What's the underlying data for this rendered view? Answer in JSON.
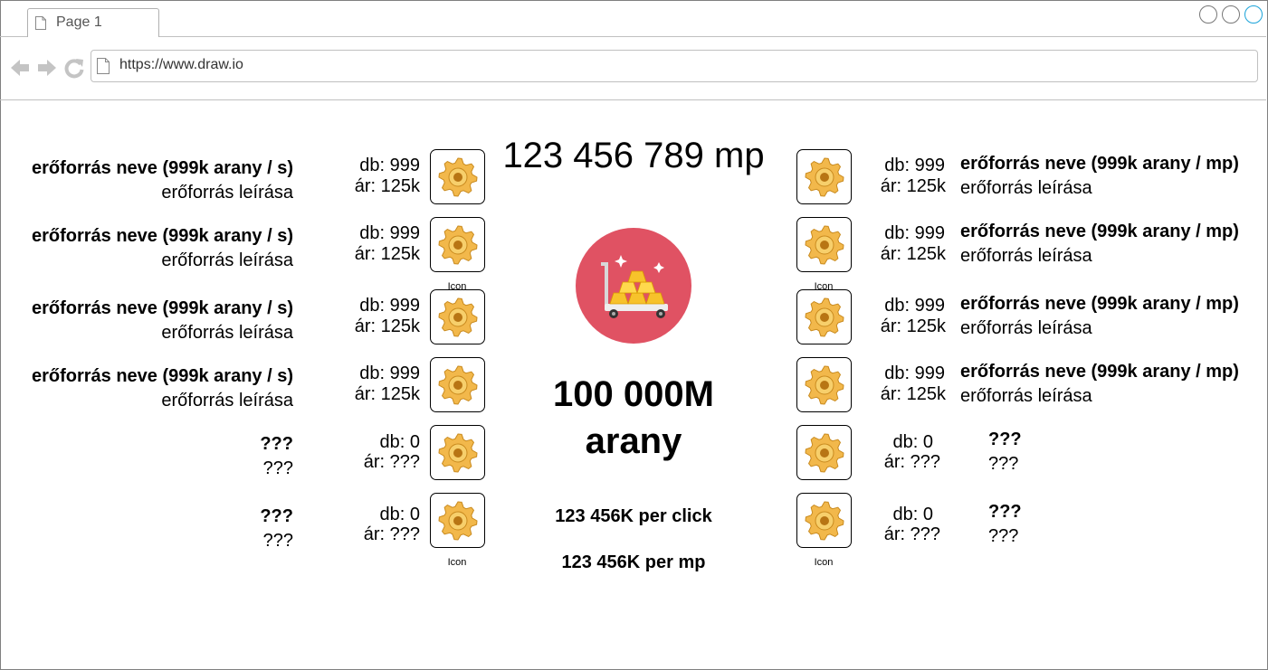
{
  "browser": {
    "tab_title": "Page 1",
    "url": "https://www.draw.io"
  },
  "game": {
    "time_counter": "123 456 789 mp",
    "gold_total_line1": "100 000M",
    "gold_total_line2": "arany",
    "per_click": "123 456K per click",
    "per_second": "123 456K per mp",
    "click_button_icon": "gold-cart-icon"
  },
  "left_resources": [
    {
      "name": "erőforrás neve (999k arany / s)",
      "desc": "erőforrás leírása",
      "count": "db: 999",
      "price": "ár: 125k"
    },
    {
      "name": "erőforrás neve (999k arany / s)",
      "desc": "erőforrás leírása",
      "count": "db: 999",
      "price": "ár: 125k"
    },
    {
      "name": "erőforrás neve (999k arany / s)",
      "desc": "erőforrás leírása",
      "count": "db: 999",
      "price": "ár: 125k"
    },
    {
      "name": "erőforrás neve (999k arany / s)",
      "desc": "erőforrás leírása",
      "count": "db: 999",
      "price": "ár: 125k"
    },
    {
      "name": "???",
      "desc": "???",
      "count": "db: 0",
      "price": "ár: ???"
    },
    {
      "name": "???",
      "desc": "???",
      "count": "db: 0",
      "price": "ár: ???"
    }
  ],
  "right_resources": [
    {
      "name": "erőforrás neve (999k arany / mp)",
      "desc": "erőforrás leírása",
      "count": "db: 999",
      "price": "ár: 125k"
    },
    {
      "name": "erőforrás neve (999k arany / mp)",
      "desc": "erőforrás leírása",
      "count": "db: 999",
      "price": "ár: 125k"
    },
    {
      "name": "erőforrás neve (999k arany / mp)",
      "desc": "erőforrás leírása",
      "count": "db: 999",
      "price": "ár: 125k"
    },
    {
      "name": "erőforrás neve (999k arany / mp)",
      "desc": "erőforrás leírása",
      "count": "db: 999",
      "price": "ár: 125k"
    },
    {
      "name": "???",
      "desc": "???",
      "count": "db: 0",
      "price": "ár: ???"
    },
    {
      "name": "???",
      "desc": "???",
      "count": "db: 0",
      "price": "ár: ???"
    }
  ],
  "icon_caption": "Icon",
  "resource_icon": "gear-icon",
  "colors": {
    "gold_button_bg": "#e05263",
    "gear": "#f2b84b",
    "active_window_button": "#1aa3d9"
  }
}
